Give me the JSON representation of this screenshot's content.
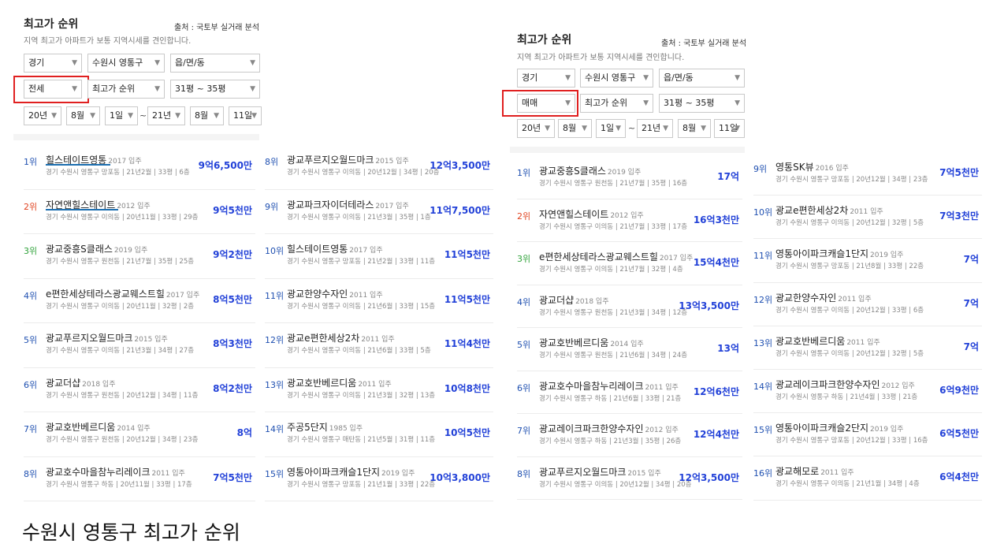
{
  "caption": "수원시 영통구 최고가 순위",
  "left": {
    "title": "최고가 순위",
    "source": "출처 : 국토부 실거래 분석",
    "desc": "지역 최고가 아파트가 보통 지역시세를 견인합니다.",
    "filters": {
      "province": "경기",
      "district": "수원시 영통구",
      "town": "읍/면/동",
      "deal_type": "전세",
      "sort": "최고가 순위",
      "size": "31평 ~ 35평",
      "from_year": "20년",
      "from_month": "8월",
      "from_day": "1일",
      "to_year": "21년",
      "to_month": "8월",
      "to_day": "11일"
    },
    "col1": [
      {
        "rank": "1위",
        "name": "힐스테이트영통",
        "year": "2017 입주",
        "meta": "경기 수원시 영통구 망포동 | 21년2월 | 33평 | 6층",
        "price": "9억6,500만"
      },
      {
        "rank": "2위",
        "name": "자연앤힐스테이트",
        "year": "2012 입주",
        "meta": "경기 수원시 영통구 이의동 | 20년11월 | 33평 | 29층",
        "price": "9억5천만"
      },
      {
        "rank": "3위",
        "name": "광교중흥S클래스",
        "year": "2019 입주",
        "meta": "경기 수원시 영통구 원천동 | 21년7월 | 35평 | 25층",
        "price": "9억2천만"
      },
      {
        "rank": "4위",
        "name": "e편한세상테라스광교웨스트힐",
        "year": "2017 입주",
        "meta": "경기 수원시 영통구 이의동 | 20년11월 | 32평 | 2층",
        "price": "8억5천만"
      },
      {
        "rank": "5위",
        "name": "광교푸르지오월드마크",
        "year": "2015 입주",
        "meta": "경기 수원시 영통구 이의동 | 21년3월 | 34평 | 27층",
        "price": "8억3천만"
      },
      {
        "rank": "6위",
        "name": "광교더샵",
        "year": "2018 입주",
        "meta": "경기 수원시 영통구 원천동 | 20년12월 | 34평 | 11층",
        "price": "8억2천만"
      },
      {
        "rank": "7위",
        "name": "광교호반베르디움",
        "year": "2014 입주",
        "meta": "경기 수원시 영통구 원천동 | 20년12월 | 34평 | 23층",
        "price": "8억"
      },
      {
        "rank": "8위",
        "name": "광교호수마을참누리레이크",
        "year": "2011 입주",
        "meta": "경기 수원시 영통구 하동 | 20년11월 | 33평 | 17층",
        "price": "7억5천만"
      }
    ],
    "col2": [
      {
        "rank": "8위",
        "name": "광교푸르지오월드마크",
        "year": "2015 입주",
        "meta": "경기 수원시 영통구 이의동 | 20년12월 | 34평 | 20층",
        "price": "12억3,500만"
      },
      {
        "rank": "9위",
        "name": "광교파크자이더테라스",
        "year": "2017 입주",
        "meta": "경기 수원시 영통구 이의동 | 21년3월 | 35평 | 1층",
        "price": "11억7,500만"
      },
      {
        "rank": "10위",
        "name": "힐스테이트영통",
        "year": "2017 입주",
        "meta": "경기 수원시 영통구 망포동 | 21년2월 | 33평 | 11층",
        "price": "11억5천만"
      },
      {
        "rank": "11위",
        "name": "광교한양수자인",
        "year": "2011 입주",
        "meta": "경기 수원시 영통구 이의동 | 21년6월 | 33평 | 15층",
        "price": "11억5천만"
      },
      {
        "rank": "12위",
        "name": "광교e편한세상2차",
        "year": "2011 입주",
        "meta": "경기 수원시 영통구 이의동 | 21년6월 | 33평 | 5층",
        "price": "11억4천만"
      },
      {
        "rank": "13위",
        "name": "광교호반베르디움",
        "year": "2011 입주",
        "meta": "경기 수원시 영통구 이의동 | 21년3월 | 32평 | 13층",
        "price": "10억8천만"
      },
      {
        "rank": "14위",
        "name": "주공5단지",
        "year": "1985 입주",
        "meta": "경기 수원시 영통구 매탄동 | 21년5월 | 31평 | 11층",
        "price": "10억5천만"
      },
      {
        "rank": "15위",
        "name": "영통아이파크캐슬1단지",
        "year": "2019 입주",
        "meta": "경기 수원시 영통구 망포동 | 21년1월 | 33평 | 22층",
        "price": "10억3,800만"
      }
    ]
  },
  "right": {
    "title": "최고가 순위",
    "source": "출처 : 국토부 실거래 분석",
    "desc": "지역 최고가 아파트가 보통 지역시세를 견인합니다.",
    "filters": {
      "province": "경기",
      "district": "수원시 영통구",
      "town": "읍/면/동",
      "deal_type": "매매",
      "sort": "최고가 순위",
      "size": "31평 ~ 35평",
      "from_year": "20년",
      "from_month": "8월",
      "from_day": "1일",
      "to_year": "21년",
      "to_month": "8월",
      "to_day": "11일"
    },
    "col1": [
      {
        "rank": "1위",
        "name": "광교중흥S클래스",
        "year": "2019 입주",
        "meta": "경기 수원시 영통구 원천동 | 21년7월 | 35평 | 16층",
        "price": "17억"
      },
      {
        "rank": "2위",
        "name": "자연앤힐스테이트",
        "year": "2012 입주",
        "meta": "경기 수원시 영통구 이의동 | 21년7월 | 33평 | 17층",
        "price": "16억3천만"
      },
      {
        "rank": "3위",
        "name": "e편한세상테라스광교웨스트힐",
        "year": "2017 입주",
        "meta": "경기 수원시 영통구 이의동 | 21년7월 | 32평 | 4층",
        "price": "15억4천만"
      },
      {
        "rank": "4위",
        "name": "광교더샵",
        "year": "2018 입주",
        "meta": "경기 수원시 영통구 원천동 | 21년3월 | 34평 | 12층",
        "price": "13억3,500만"
      },
      {
        "rank": "5위",
        "name": "광교호반베르디움",
        "year": "2014 입주",
        "meta": "경기 수원시 영통구 원천동 | 21년6월 | 34평 | 24층",
        "price": "13억"
      },
      {
        "rank": "6위",
        "name": "광교호수마을참누리레이크",
        "year": "2011 입주",
        "meta": "경기 수원시 영통구 하동 | 21년6월 | 33평 | 21층",
        "price": "12억6천만"
      },
      {
        "rank": "7위",
        "name": "광교레이크파크한양수자인",
        "year": "2012 입주",
        "meta": "경기 수원시 영통구 하동 | 21년3월 | 35평 | 26층",
        "price": "12억4천만"
      },
      {
        "rank": "8위",
        "name": "광교푸르지오월드마크",
        "year": "2015 입주",
        "meta": "경기 수원시 영통구 이의동 | 20년12월 | 34평 | 20층",
        "price": "12억3,500만"
      }
    ],
    "col2": [
      {
        "rank": "9위",
        "name": "영통SK뷰",
        "year": "2016 입주",
        "meta": "경기 수원시 영통구 망포동 | 20년12월 | 34평 | 23층",
        "price": "7억5천만"
      },
      {
        "rank": "10위",
        "name": "광교e편한세상2차",
        "year": "2011 입주",
        "meta": "경기 수원시 영통구 이의동 | 20년12월 | 32평 | 5층",
        "price": "7억3천만"
      },
      {
        "rank": "11위",
        "name": "영통아이파크캐슬1단지",
        "year": "2019 입주",
        "meta": "경기 수원시 영통구 망포동 | 21년8월 | 33평 | 22층",
        "price": "7억"
      },
      {
        "rank": "12위",
        "name": "광교한양수자인",
        "year": "2011 입주",
        "meta": "경기 수원시 영통구 이의동 | 20년12월 | 33평 | 6층",
        "price": "7억"
      },
      {
        "rank": "13위",
        "name": "광교호반베르디움",
        "year": "2011 입주",
        "meta": "경기 수원시 영통구 이의동 | 20년12월 | 32평 | 5층",
        "price": "7억"
      },
      {
        "rank": "14위",
        "name": "광교레이크파크한양수자인",
        "year": "2012 입주",
        "meta": "경기 수원시 영통구 하동 | 21년4월 | 33평 | 21층",
        "price": "6억9천만"
      },
      {
        "rank": "15위",
        "name": "영통아이파크캐슬2단지",
        "year": "2019 입주",
        "meta": "경기 수원시 영통구 망포동 | 20년12월 | 33평 | 16층",
        "price": "6억5천만"
      },
      {
        "rank": "16위",
        "name": "광교해모로",
        "year": "2011 입주",
        "meta": "경기 수원시 영통구 이의동 | 21년1월 | 34평 | 4층",
        "price": "6억4천만"
      }
    ]
  }
}
